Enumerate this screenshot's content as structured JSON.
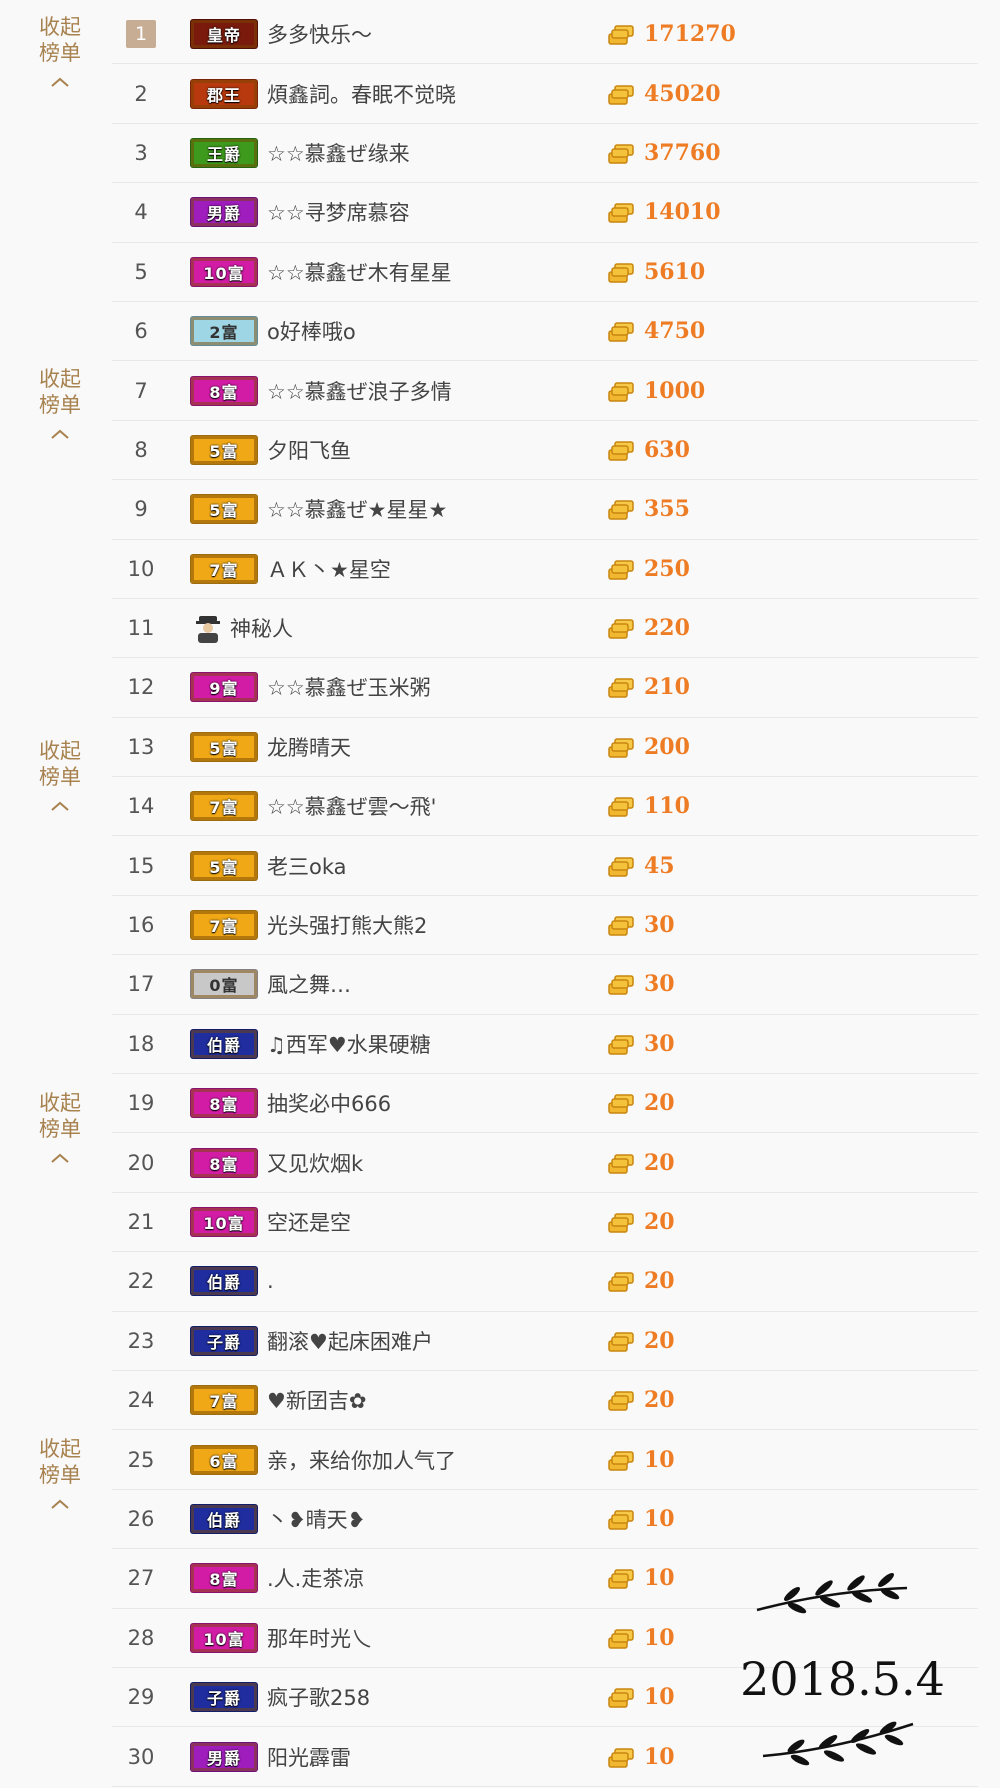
{
  "collapse_label_line1": "收起",
  "collapse_label_line2": "榜单",
  "colors": {
    "accent": "#ee7c24",
    "muted": "#a8824f",
    "top_rank_bg": "#c7ad93"
  },
  "rows": [
    {
      "rank": "1",
      "badge": "皇帝",
      "badge_color": "#7a1a0c",
      "name": "多多快乐～",
      "amount": "171270"
    },
    {
      "rank": "2",
      "badge": "郡王",
      "badge_color": "#b8390e",
      "name": "煩鑫詞。春眠不觉晓",
      "amount": "45020"
    },
    {
      "rank": "3",
      "badge": "王爵",
      "badge_color": "#3d9a1d",
      "name": "☆☆慕鑫ぜ缘来",
      "amount": "37760"
    },
    {
      "rank": "4",
      "badge": "男爵",
      "badge_color": "#a01dbd",
      "name": "☆☆寻梦席慕容",
      "amount": "14010"
    },
    {
      "rank": "5",
      "badge": "10富",
      "badge_color": "#d21ca6",
      "name": "☆☆慕鑫ぜ木有星星",
      "amount": "5610"
    },
    {
      "rank": "6",
      "badge": "2富",
      "badge_color": "#9fd6e6",
      "name": "o好棒哦o",
      "amount": "4750"
    },
    {
      "rank": "7",
      "badge": "8富",
      "badge_color": "#d21ca6",
      "name": "☆☆慕鑫ぜ浪子多情",
      "amount": "1000"
    },
    {
      "rank": "8",
      "badge": "5富",
      "badge_color": "#f0a817",
      "name": "夕阳飞鱼",
      "amount": "630"
    },
    {
      "rank": "9",
      "badge": "5富",
      "badge_color": "#f0a817",
      "name": "☆☆慕鑫ぜ★星星★",
      "amount": "355"
    },
    {
      "rank": "10",
      "badge": "7富",
      "badge_color": "#f0a817",
      "name": "ＡＫ丶★星空",
      "amount": "250"
    },
    {
      "rank": "11",
      "badge": "",
      "badge_color": "",
      "icon": "mystery-person-icon",
      "name": "神秘人",
      "amount": "220"
    },
    {
      "rank": "12",
      "badge": "9富",
      "badge_color": "#d21ca6",
      "name": "☆☆慕鑫ぜ玉米粥",
      "amount": "210"
    },
    {
      "rank": "13",
      "badge": "5富",
      "badge_color": "#f0a817",
      "name": "龙腾晴天",
      "amount": "200"
    },
    {
      "rank": "14",
      "badge": "7富",
      "badge_color": "#f0a817",
      "name": "☆☆慕鑫ぜ雲～飛'",
      "amount": "110"
    },
    {
      "rank": "15",
      "badge": "5富",
      "badge_color": "#f0a817",
      "name": "老三oka",
      "amount": "45"
    },
    {
      "rank": "16",
      "badge": "7富",
      "badge_color": "#f0a817",
      "name": "光头强打熊大熊2",
      "amount": "30"
    },
    {
      "rank": "17",
      "badge": "0富",
      "badge_color": "#c8c8c8",
      "name": "風之舞…",
      "amount": "30"
    },
    {
      "rank": "18",
      "badge": "伯爵",
      "badge_color": "#1f2d9e",
      "name": "♫西军♥水果硬糖",
      "amount": "30"
    },
    {
      "rank": "19",
      "badge": "8富",
      "badge_color": "#d21ca6",
      "name": "抽奖必中666",
      "amount": "20"
    },
    {
      "rank": "20",
      "badge": "8富",
      "badge_color": "#d21ca6",
      "name": "又见炊烟k",
      "amount": "20"
    },
    {
      "rank": "21",
      "badge": "10富",
      "badge_color": "#d21ca6",
      "name": "空还是空",
      "amount": "20"
    },
    {
      "rank": "22",
      "badge": "伯爵",
      "badge_color": "#1f2d9e",
      "name": ".",
      "amount": "20"
    },
    {
      "rank": "23",
      "badge": "子爵",
      "badge_color": "#1f2d9e",
      "name": "翻滚♥起床困难户",
      "amount": "20"
    },
    {
      "rank": "24",
      "badge": "7富",
      "badge_color": "#f0a817",
      "name": "♥新囝吉✿",
      "amount": "20"
    },
    {
      "rank": "25",
      "badge": "6富",
      "badge_color": "#f0a817",
      "name": "亲，来给你加人气了",
      "amount": "10"
    },
    {
      "rank": "26",
      "badge": "伯爵",
      "badge_color": "#1f2d9e",
      "name": "丶❥晴天❥",
      "amount": "10"
    },
    {
      "rank": "27",
      "badge": "8富",
      "badge_color": "#d21ca6",
      "name": ".人.走茶凉",
      "amount": "10"
    },
    {
      "rank": "28",
      "badge": "10富",
      "badge_color": "#d21ca6",
      "name": "那年时光乀",
      "amount": "10"
    },
    {
      "rank": "29",
      "badge": "子爵",
      "badge_color": "#1f2d9e",
      "name": "疯子歌258",
      "amount": "10"
    },
    {
      "rank": "30",
      "badge": "男爵",
      "badge_color": "#a01dbd",
      "name": "阳光霹雷",
      "amount": "10"
    }
  ],
  "date_stamp": "2018.5.4"
}
